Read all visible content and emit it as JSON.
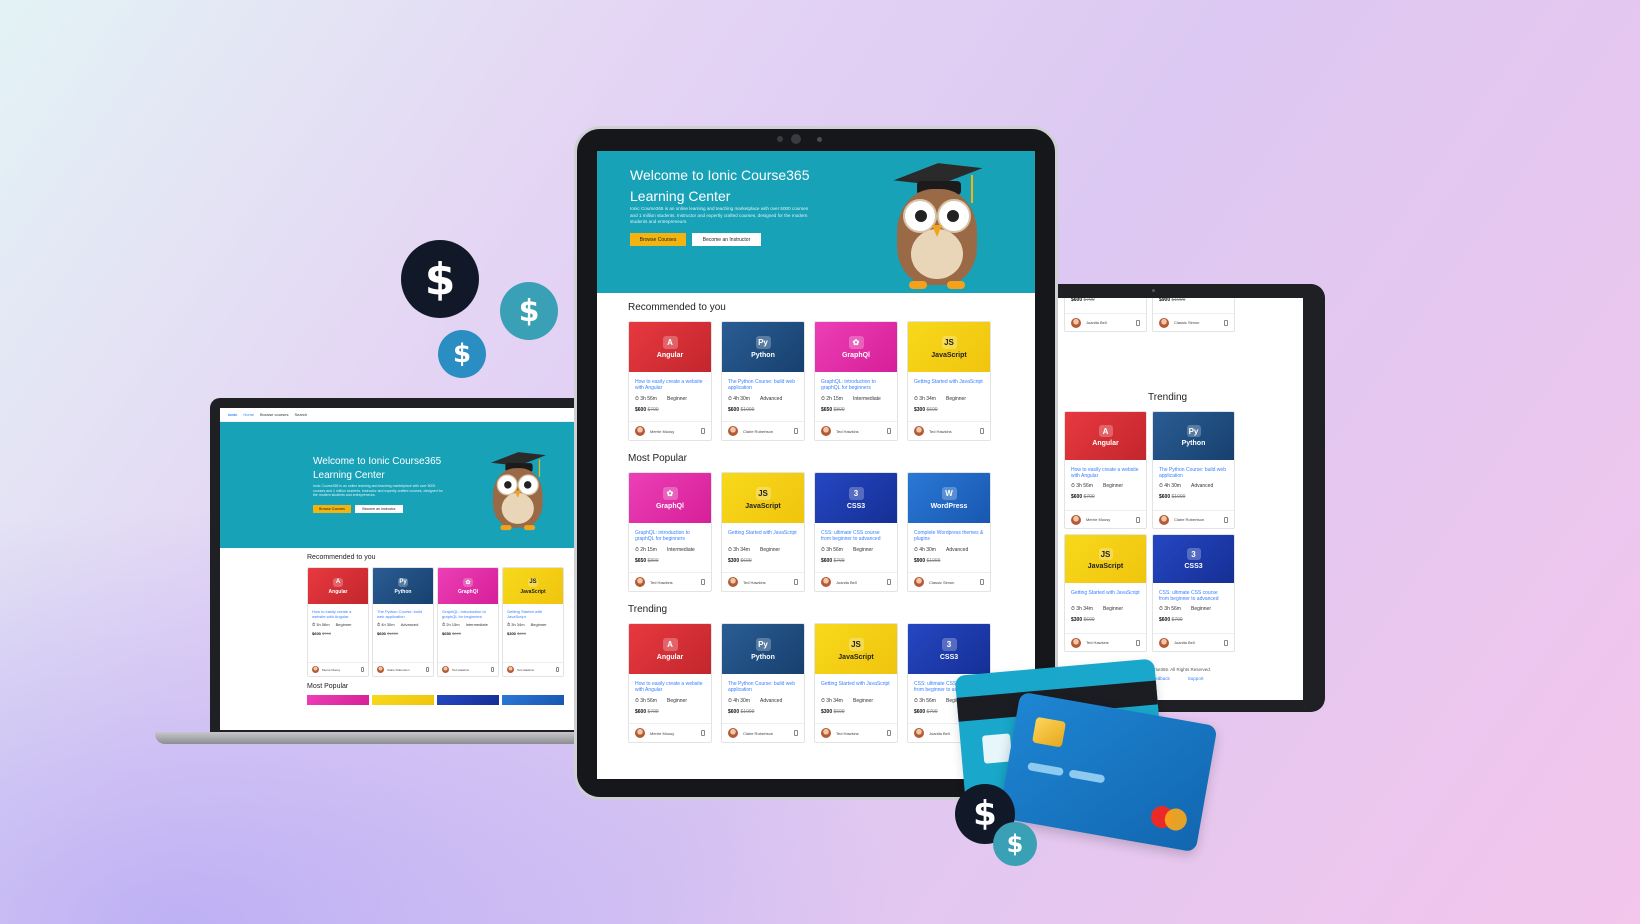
{
  "hero": {
    "title": "Welcome to Ionic Course365 Learning Center",
    "description": "Ionic Course365 is an online learning and teaching marketplace with over 5000 courses and 1 million students. Instructor and expertly crafted courses, designed for the modern students and entrepreneurs.",
    "browse_label": "Browse Courses",
    "instructor_label": "Become an Instructor"
  },
  "laptop_nav": {
    "brand": "ionic",
    "items": [
      "Home",
      "Browse courses",
      "Search"
    ]
  },
  "sections": {
    "recommended": "Recommended to you",
    "popular": "Most Popular",
    "trending": "Trending"
  },
  "courses": {
    "angular": {
      "tech": "Angular",
      "title": "How to easily create a website with Angular",
      "duration": "3h 56m",
      "level": "Beginner",
      "price": "$600",
      "old_price": "$799",
      "author": "Merrie Moosy"
    },
    "python": {
      "tech": "Python",
      "title": "The Python Course: build web application",
      "duration": "4h 30m",
      "level": "Advanced",
      "price": "$600",
      "old_price": "$1099",
      "author": "Claire Robertson"
    },
    "graphql": {
      "tech": "GraphQl",
      "title": "GraphQL: introduction to graphQL for beginners",
      "duration": "2h 15m",
      "level": "Intermediate",
      "price": "$650",
      "old_price": "$899",
      "author": "Ted Hawkins"
    },
    "javascript": {
      "tech": "JavaScript",
      "title": "Getting Started with JavaScript",
      "duration": "3h 34m",
      "level": "Beginner",
      "price": "$300",
      "old_price": "$699",
      "author": "Ted Hawkins"
    },
    "css3": {
      "tech": "CSS3",
      "title": "CSS: ultimate CSS course from beginner to advanced",
      "duration": "3h 56m",
      "level": "Beginner",
      "price": "$600",
      "old_price": "$799",
      "author": "Juanita Bell"
    },
    "wordpress": {
      "tech": "WordPress",
      "title": "Complete Wordpress themes & plugins",
      "duration": "4h 30m",
      "level": "Advanced",
      "price": "$900",
      "old_price": "$1099",
      "author": "Classic Simon"
    }
  },
  "footer": {
    "copyright": "Course365. All Rights Reserved.",
    "links": [
      "Feedback",
      "Support"
    ]
  },
  "icons": {
    "angular": "A",
    "python": "Py",
    "graphql": "✿",
    "javascript": "JS",
    "css3": "3",
    "wordpress": "W",
    "coin": "$",
    "clock": "⏱"
  },
  "colors": {
    "hero": "#17a2b8",
    "button": "#f3b311",
    "link": "#3880ff"
  }
}
